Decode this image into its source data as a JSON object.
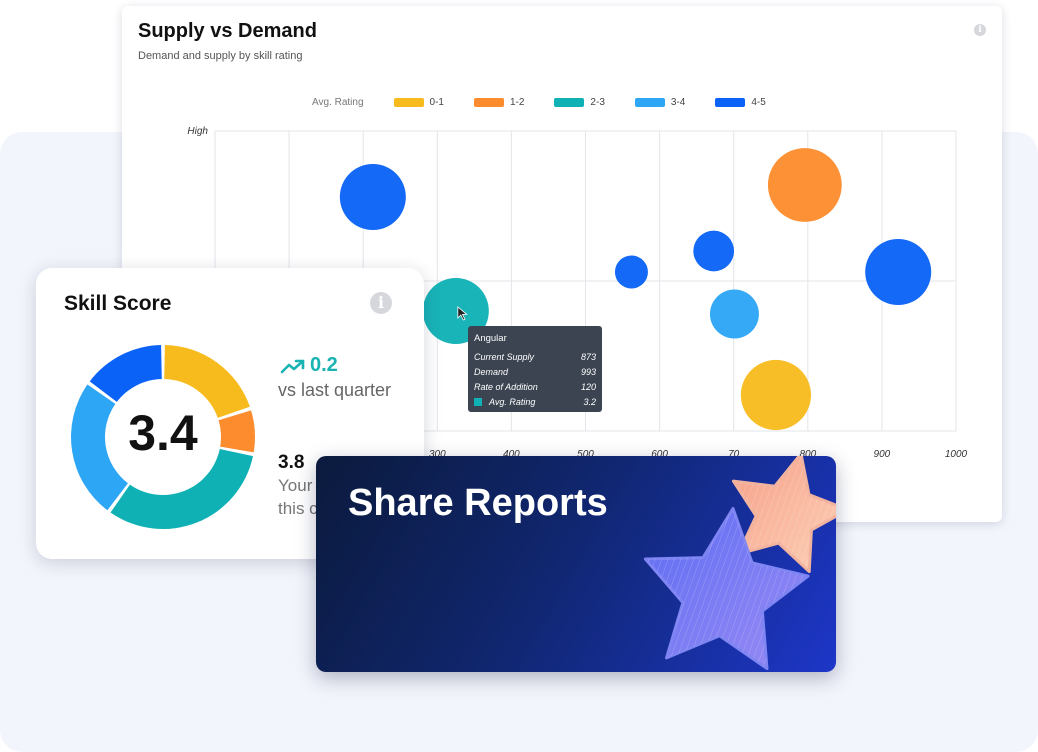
{
  "supply_demand": {
    "title": "Supply vs Demand",
    "subtitle": "Demand and supply by skill rating",
    "info_icon": "info-icon",
    "legend": {
      "title": "Avg. Rating",
      "items": [
        {
          "label": "0-1",
          "color": "#f7bb1e"
        },
        {
          "label": "1-2",
          "color": "#fd8c2e"
        },
        {
          "label": "2-3",
          "color": "#10b1b5"
        },
        {
          "label": "3-4",
          "color": "#2ea6f6"
        },
        {
          "label": "4-5",
          "color": "#0a63f6"
        }
      ]
    },
    "tooltip": {
      "title": "Angular",
      "rows": [
        {
          "label": "Current Supply",
          "value": "873"
        },
        {
          "label": "Demand",
          "value": "993"
        },
        {
          "label": "Rate of Addition",
          "value": "120"
        },
        {
          "label": "Avg. Rating",
          "value": "3.2",
          "color": "#10b1b5"
        }
      ]
    }
  },
  "chart_data": {
    "type": "scatter",
    "title": "Supply vs Demand",
    "subtitle": "Demand and supply by skill rating",
    "ylabel_top": "High",
    "x_ticks": [
      "300",
      "400",
      "500",
      "600",
      "70",
      "800",
      "900",
      "1000"
    ],
    "x_tick_values": [
      300,
      400,
      500,
      600,
      700,
      800,
      900,
      1000
    ],
    "xlim": [
      0,
      1000
    ],
    "ylim": [
      0,
      100
    ],
    "grid": true,
    "legend_position": "top",
    "points": [
      {
        "x": 213,
        "y": 78,
        "size": 100,
        "rating": "4-5"
      },
      {
        "x": 325,
        "y": 40,
        "size": 100,
        "rating": "2-3"
      },
      {
        "x": 562,
        "y": 53,
        "size": 25,
        "rating": "4-5"
      },
      {
        "x": 673,
        "y": 60,
        "size": 38,
        "rating": "4-5"
      },
      {
        "x": 701,
        "y": 39,
        "size": 55,
        "rating": "3-4"
      },
      {
        "x": 757,
        "y": 12,
        "size": 113,
        "rating": "0-1"
      },
      {
        "x": 796,
        "y": 82,
        "size": 125,
        "rating": "1-2"
      },
      {
        "x": 922,
        "y": 53,
        "size": 100,
        "rating": "4-5"
      }
    ]
  },
  "skill_score": {
    "title": "Skill Score",
    "score": "3.4",
    "delta_icon": "trending-up-icon",
    "delta": "0.2",
    "delta_label": "vs last quarter",
    "secondary_score": "3.8",
    "secondary_line1": "Your",
    "secondary_line2": "this c",
    "donut": [
      {
        "value": 20,
        "color": "#f7bb1e"
      },
      {
        "value": 8,
        "color": "#fd8c2e"
      },
      {
        "value": 32,
        "color": "#10b1b5"
      },
      {
        "value": 25,
        "color": "#2ea6f6"
      },
      {
        "value": 15,
        "color": "#0a63f6"
      }
    ]
  },
  "share_reports": {
    "title": "Share Reports"
  }
}
